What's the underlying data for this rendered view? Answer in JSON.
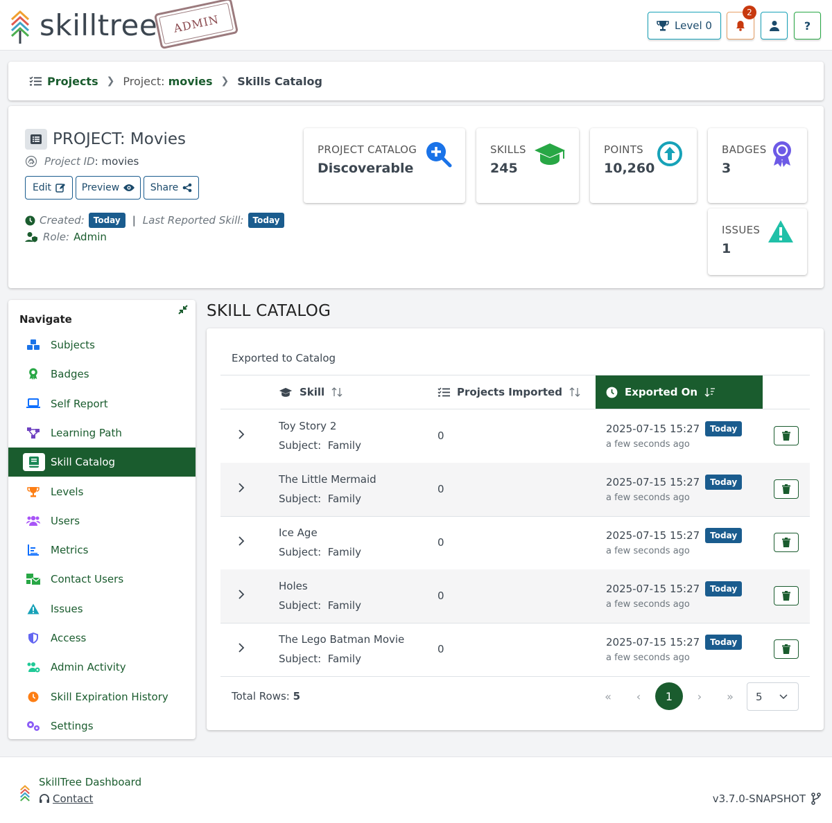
{
  "header": {
    "logo_text": "skilltree",
    "stamp_text": "ADMIN",
    "level_label": "Level 0",
    "notification_count": "2",
    "help_label": "?"
  },
  "breadcrumb": {
    "projects": "Projects",
    "project_prefix": "Project:",
    "project_name": "movies",
    "current": "Skills Catalog"
  },
  "project": {
    "title": "PROJECT: Movies",
    "id_label": "Project ID",
    "id_value": ": movies",
    "buttons": {
      "edit": "Edit",
      "preview": "Preview",
      "share": "Share"
    },
    "created_label": "Created:",
    "created_value": "Today",
    "separator": "|",
    "last_reported_label": "Last Reported Skill:",
    "last_reported_value": "Today",
    "role_label": "Role:",
    "role_value": "Admin"
  },
  "stats": {
    "catalog": {
      "label": "PROJECT CATALOG",
      "value": "Discoverable"
    },
    "skills": {
      "label": "SKILLS",
      "value": "245"
    },
    "points": {
      "label": "POINTS",
      "value": "10,260"
    },
    "badges": {
      "label": "BADGES",
      "value": "3"
    },
    "issues": {
      "label": "ISSUES",
      "value": "1"
    }
  },
  "sidebar": {
    "title": "Navigate",
    "items": [
      {
        "label": "Subjects",
        "icon": "cubes-icon",
        "color": "#1a73e8"
      },
      {
        "label": "Badges",
        "icon": "award-icon",
        "color": "#28a745"
      },
      {
        "label": "Self Report",
        "icon": "laptop-icon",
        "color": "#0d6efd"
      },
      {
        "label": "Learning Path",
        "icon": "network-icon",
        "color": "#6f42c1"
      },
      {
        "label": "Skill Catalog",
        "icon": "book-icon",
        "color": "#198754"
      },
      {
        "label": "Levels",
        "icon": "trophy-icon",
        "color": "#fd7e14"
      },
      {
        "label": "Users",
        "icon": "users-icon",
        "color": "#a855f7"
      },
      {
        "label": "Metrics",
        "icon": "chart-icon",
        "color": "#0d6efd"
      },
      {
        "label": "Contact Users",
        "icon": "mail-bulk-icon",
        "color": "#28a745"
      },
      {
        "label": "Issues",
        "icon": "warning-icon",
        "color": "#17a2b8"
      },
      {
        "label": "Access",
        "icon": "shield-icon",
        "color": "#6366f1"
      },
      {
        "label": "Admin Activity",
        "icon": "users-cog-icon",
        "color": "#20c997"
      },
      {
        "label": "Skill Expiration History",
        "icon": "clock-icon",
        "color": "#fd7e14"
      },
      {
        "label": "Settings",
        "icon": "cogs-icon",
        "color": "#8b5cf6"
      }
    ]
  },
  "main": {
    "title": "SKILL CATALOG",
    "table_title": "Exported to Catalog",
    "columns": {
      "skill": "Skill",
      "imported": "Projects Imported",
      "exported": "Exported On"
    },
    "subject_prefix": "Subject:",
    "today_badge": "Today",
    "rows": [
      {
        "skill": "Toy Story 2",
        "subject": "Family",
        "imported": "0",
        "date": "2025-07-15 15:27",
        "ago": "a few seconds ago"
      },
      {
        "skill": "The Little Mermaid",
        "subject": "Family",
        "imported": "0",
        "date": "2025-07-15 15:27",
        "ago": "a few seconds ago"
      },
      {
        "skill": "Ice Age",
        "subject": "Family",
        "imported": "0",
        "date": "2025-07-15 15:27",
        "ago": "a few seconds ago"
      },
      {
        "skill": "Holes",
        "subject": "Family",
        "imported": "0",
        "date": "2025-07-15 15:27",
        "ago": "a few seconds ago"
      },
      {
        "skill": "The Lego Batman Movie",
        "subject": "Family",
        "imported": "0",
        "date": "2025-07-15 15:27",
        "ago": "a few seconds ago"
      }
    ],
    "total_label": "Total Rows:",
    "total_value": "5",
    "pagination": {
      "first": "«",
      "prev": "‹",
      "current": "1",
      "next": "›",
      "last": "»",
      "page_size": "5"
    }
  },
  "footer": {
    "name": "SkillTree Dashboard",
    "contact": "Contact",
    "version": "v3.7.0-SNAPSHOT"
  }
}
